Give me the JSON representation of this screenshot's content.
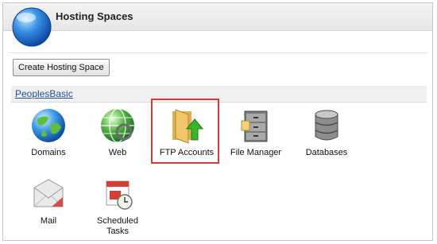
{
  "header": {
    "title": "Hosting Spaces",
    "logo_icon": "globe-icon"
  },
  "toolbar": {
    "create_label": "Create Hosting Space"
  },
  "space": {
    "name": "PeoplesBasic",
    "items": [
      {
        "label": "Domains",
        "icon": "globe-domains-icon"
      },
      {
        "label": "Web",
        "icon": "web-globe-icon"
      },
      {
        "label": "FTP Accounts",
        "icon": "ftp-folder-icon",
        "highlighted": true
      },
      {
        "label": "File Manager",
        "icon": "file-cabinet-icon"
      },
      {
        "label": "Databases",
        "icon": "database-icon"
      },
      {
        "label": "Mail",
        "icon": "envelope-icon"
      },
      {
        "label": "Scheduled",
        "label2": "Tasks",
        "icon": "calendar-clock-icon"
      }
    ]
  },
  "colors": {
    "highlight": "#d53b36",
    "link": "#1f4e9e"
  }
}
